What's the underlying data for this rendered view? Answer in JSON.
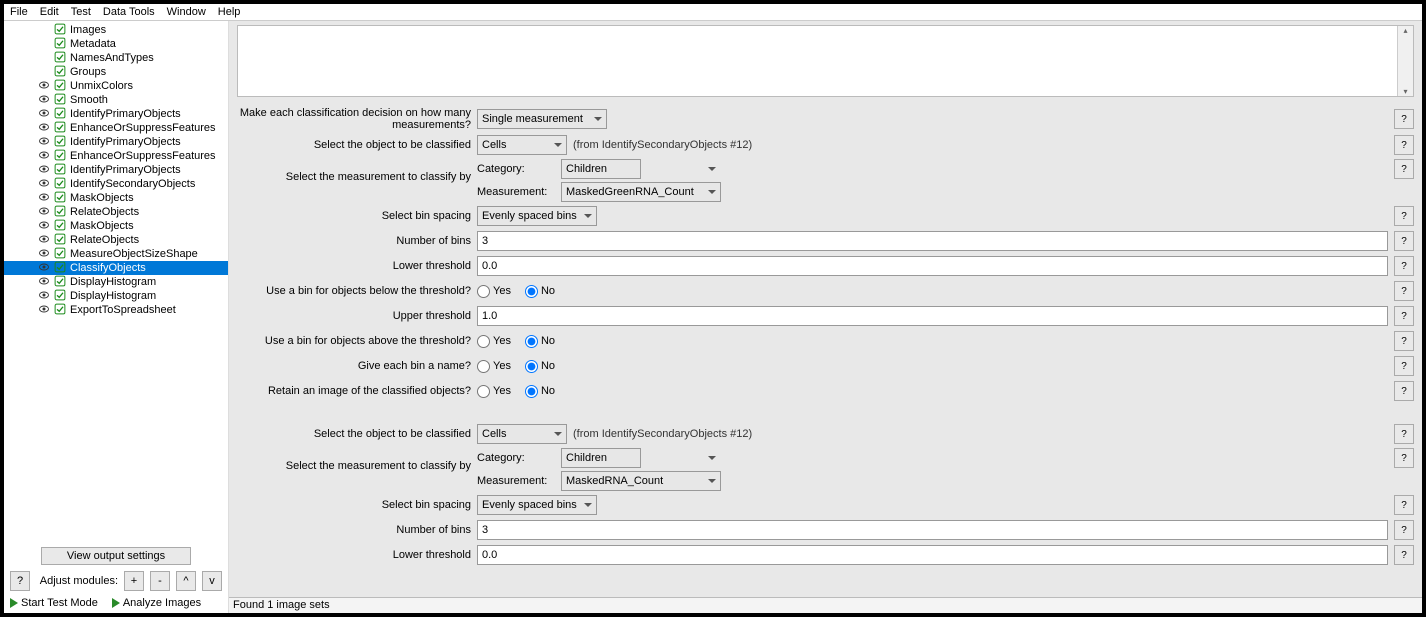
{
  "menu": [
    "File",
    "Edit",
    "Test",
    "Data Tools",
    "Window",
    "Help"
  ],
  "modules": [
    {
      "name": "Images",
      "eye": false
    },
    {
      "name": "Metadata",
      "eye": false
    },
    {
      "name": "NamesAndTypes",
      "eye": false
    },
    {
      "name": "Groups",
      "eye": false
    },
    {
      "name": "UnmixColors",
      "eye": true
    },
    {
      "name": "Smooth",
      "eye": true
    },
    {
      "name": "IdentifyPrimaryObjects",
      "eye": true
    },
    {
      "name": "EnhanceOrSuppressFeatures",
      "eye": true
    },
    {
      "name": "IdentifyPrimaryObjects",
      "eye": true
    },
    {
      "name": "EnhanceOrSuppressFeatures",
      "eye": true
    },
    {
      "name": "IdentifyPrimaryObjects",
      "eye": true
    },
    {
      "name": "IdentifySecondaryObjects",
      "eye": true
    },
    {
      "name": "MaskObjects",
      "eye": true
    },
    {
      "name": "RelateObjects",
      "eye": true
    },
    {
      "name": "MaskObjects",
      "eye": true
    },
    {
      "name": "RelateObjects",
      "eye": true
    },
    {
      "name": "MeasureObjectSizeShape",
      "eye": true
    },
    {
      "name": "ClassifyObjects",
      "eye": true,
      "selected": true
    },
    {
      "name": "DisplayHistogram",
      "eye": true
    },
    {
      "name": "DisplayHistogram",
      "eye": true
    },
    {
      "name": "ExportToSpreadsheet",
      "eye": true
    }
  ],
  "sidebar": {
    "view_output": "View output settings",
    "adjust_label": "Adjust modules:",
    "plus": "+",
    "minus": "-",
    "up": "^",
    "down": "v",
    "start_test": "Start Test Mode",
    "analyze": "Analyze Images"
  },
  "settings": {
    "q1": "Make each classification decision on how many measurements?",
    "q1_val": "Single measurement",
    "q2": "Select the object to be classified",
    "q2_val": "Cells",
    "q2_hint": "(from IdentifySecondaryObjects #12)",
    "q3": "Select the measurement to classify by",
    "cat_label": "Category:",
    "cat_val": "Children",
    "meas_label": "Measurement:",
    "meas_val": "MaskedGreenRNA_Count",
    "q4": "Select bin spacing",
    "q4_val": "Evenly spaced bins",
    "q5": "Number of bins",
    "q5_val": "3",
    "q6": "Lower threshold",
    "q6_val": "0.0",
    "q7": "Use a bin for objects below the threshold?",
    "yes": "Yes",
    "no": "No",
    "q8": "Upper threshold",
    "q8_val": "1.0",
    "q9": "Use a bin for objects above the threshold?",
    "q10": "Give each bin a name?",
    "q11": "Retain an image of the classified objects?",
    "b_q2": "Select the object to be classified",
    "b_q2_val": "Cells",
    "b_q2_hint": "(from IdentifySecondaryObjects #12)",
    "b_q3": "Select the measurement to classify by",
    "b_cat_val": "Children",
    "b_meas_val": "MaskedRNA_Count",
    "b_q4": "Select bin spacing",
    "b_q4_val": "Evenly spaced bins",
    "b_q5": "Number of bins",
    "b_q5_val": "3",
    "b_q6": "Lower threshold",
    "b_q6_val": "0.0",
    "help": "?"
  },
  "status": "Found 1 image sets"
}
